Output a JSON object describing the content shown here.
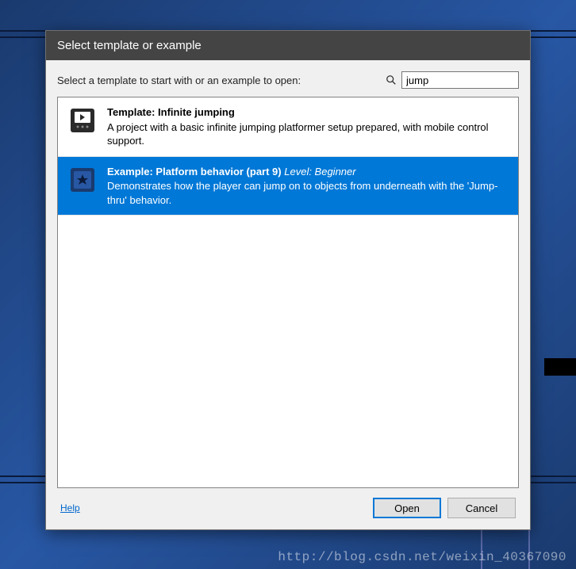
{
  "dialog": {
    "title": "Select template or example",
    "instruction": "Select a template to start with or an example to open:",
    "search": {
      "value": "jump"
    }
  },
  "items": [
    {
      "title": "Template: Infinite jumping",
      "level": "",
      "desc": "A project with a basic infinite jumping platformer setup prepared, with mobile control support.",
      "selected": false
    },
    {
      "title": "Example: Platform behavior (part 9)",
      "level": "Level: Beginner",
      "desc": "Demonstrates how the player can jump on to objects from underneath with the 'Jump-thru' behavior.",
      "selected": true
    }
  ],
  "footer": {
    "help": "Help",
    "open": "Open",
    "cancel": "Cancel"
  },
  "watermark": "http://blog.csdn.net/weixin_40367090"
}
